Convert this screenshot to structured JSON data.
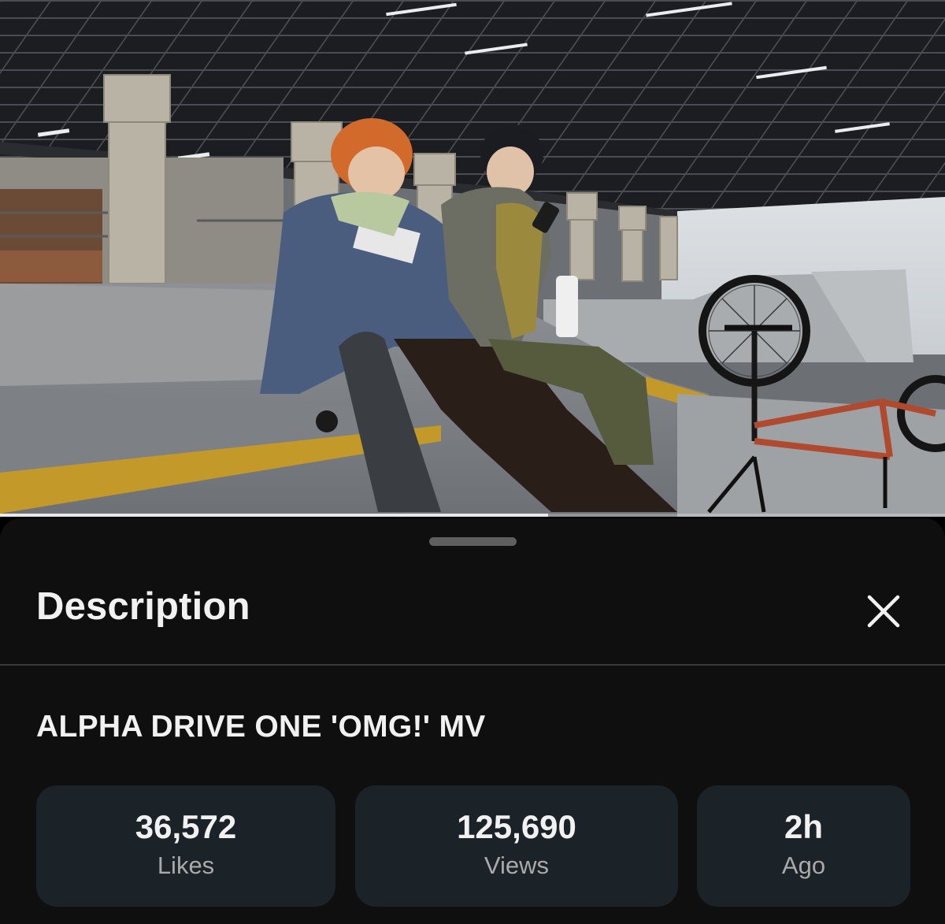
{
  "player": {
    "progress": 0.58
  },
  "sheet": {
    "title": "Description",
    "close_icon": "close-icon"
  },
  "video": {
    "title": "ALPHA DRIVE ONE 'OMG!' MV"
  },
  "stats": [
    {
      "value": "36,572",
      "label": "Likes"
    },
    {
      "value": "125,690",
      "label": "Views"
    },
    {
      "value": "2h",
      "label": "Ago"
    }
  ],
  "colors": {
    "sheet_bg": "#0f0f0f",
    "stat_bg": "#1b2228",
    "text_primary": "#f1f1f1",
    "text_secondary": "#aaaaaa"
  }
}
